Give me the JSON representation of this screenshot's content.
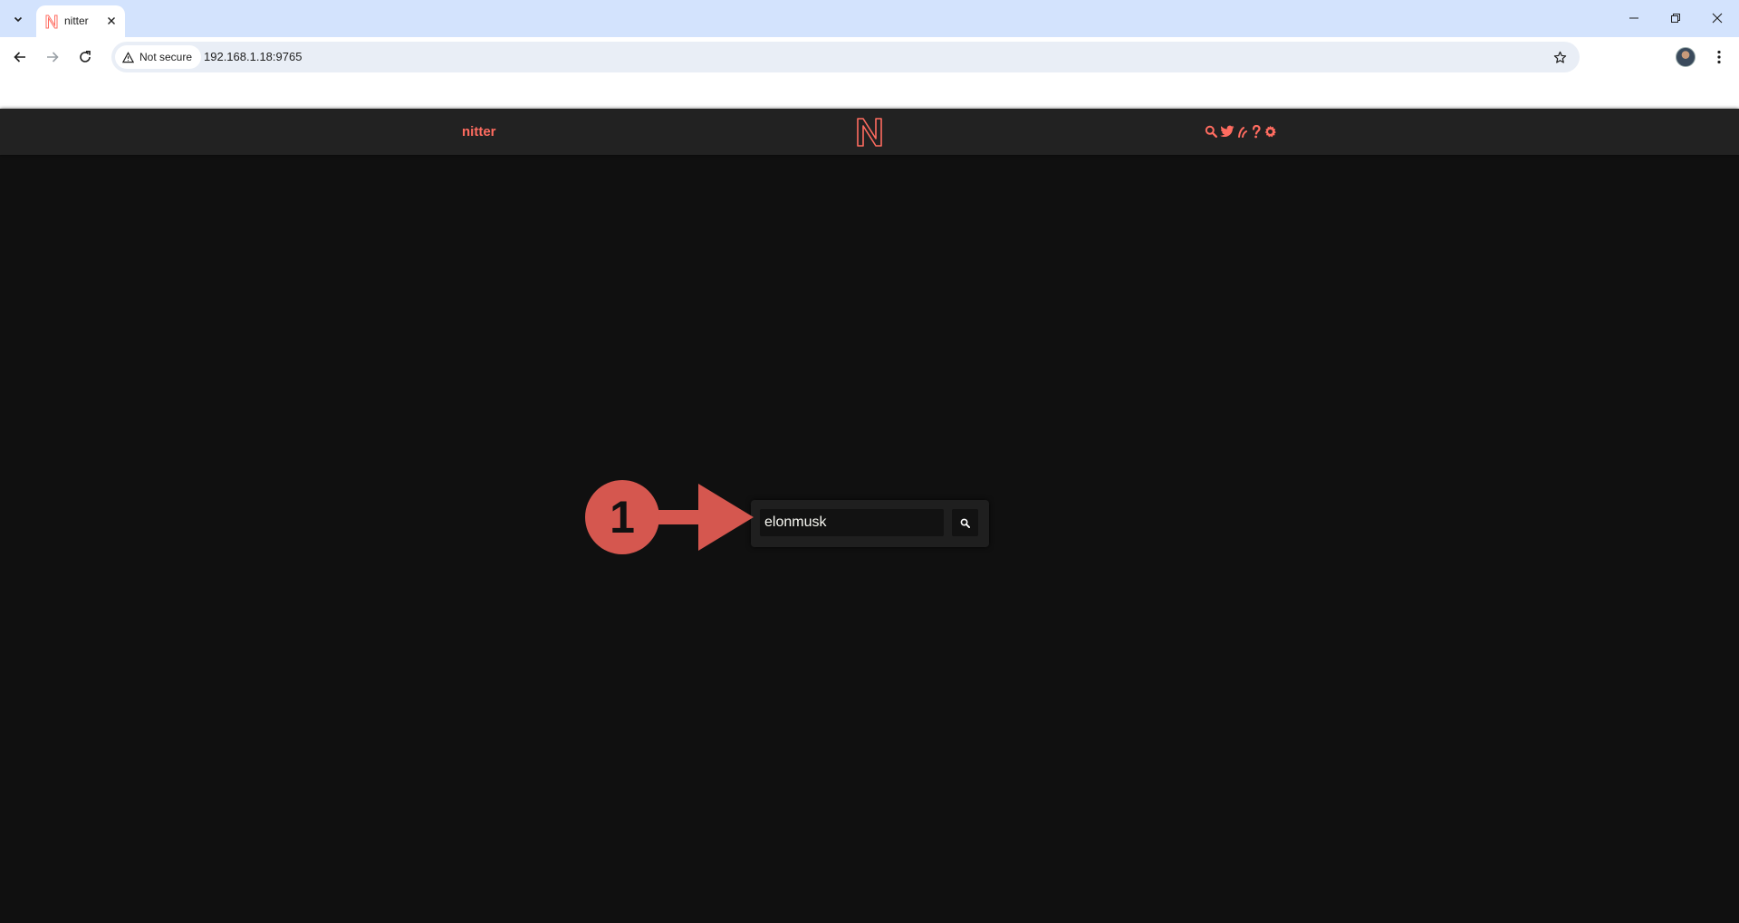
{
  "browser": {
    "tab": {
      "title": "nitter",
      "favicon": "nitter-n-logo"
    },
    "security_label": "Not secure",
    "url": "192.168.1.18:9765",
    "colors": {
      "tabstrip": "#d3e3fd",
      "omnibox": "#e9eef6"
    }
  },
  "site": {
    "name": "nitter",
    "logo": "nitter-n-logo",
    "nav_icons": [
      "search-icon",
      "twitter-bird-icon",
      "rss-icon",
      "help-icon",
      "gear-icon"
    ],
    "colors": {
      "accent": "#ff6c60",
      "background": "#101010",
      "navbar": "#222222"
    }
  },
  "search": {
    "value": "elonmusk",
    "button_icon": "search-icon"
  },
  "annotation": {
    "step_number": "1",
    "color": "#d5574f"
  }
}
